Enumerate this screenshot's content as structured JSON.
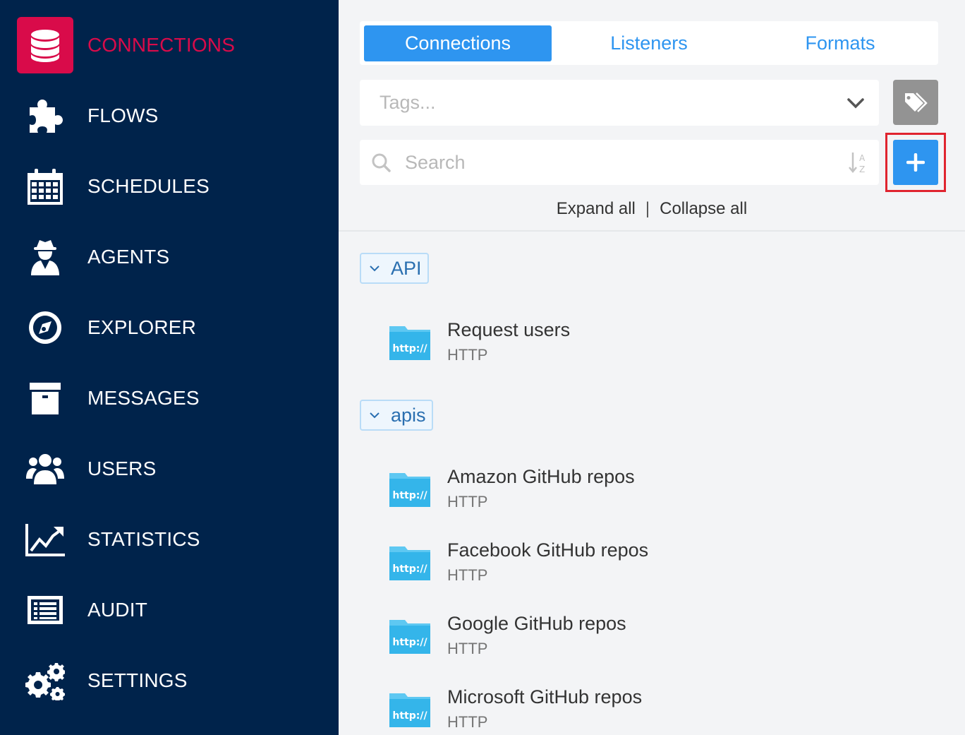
{
  "sidebar": {
    "items": [
      {
        "label": "CONNECTIONS",
        "icon": "database-icon",
        "active": true
      },
      {
        "label": "FLOWS",
        "icon": "puzzle-icon"
      },
      {
        "label": "SCHEDULES",
        "icon": "calendar-icon"
      },
      {
        "label": "AGENTS",
        "icon": "agent-icon"
      },
      {
        "label": "EXPLORER",
        "icon": "compass-icon"
      },
      {
        "label": "MESSAGES",
        "icon": "archive-icon"
      },
      {
        "label": "USERS",
        "icon": "users-icon"
      },
      {
        "label": "STATISTICS",
        "icon": "chart-line-icon"
      },
      {
        "label": "AUDIT",
        "icon": "list-icon"
      },
      {
        "label": "SETTINGS",
        "icon": "gears-icon"
      }
    ]
  },
  "tabs": [
    {
      "label": "Connections",
      "active": true
    },
    {
      "label": "Listeners"
    },
    {
      "label": "Formats"
    }
  ],
  "tags": {
    "placeholder": "Tags..."
  },
  "search": {
    "placeholder": "Search"
  },
  "actions": {
    "expand_all": "Expand all",
    "separator": "|",
    "collapse_all": "Collapse all"
  },
  "groups": [
    {
      "name": "API",
      "items": [
        {
          "name": "Request users",
          "type": "HTTP"
        }
      ]
    },
    {
      "name": "apis",
      "items": [
        {
          "name": "Amazon GitHub repos",
          "type": "HTTP"
        },
        {
          "name": "Facebook GitHub repos",
          "type": "HTTP"
        },
        {
          "name": "Google GitHub repos",
          "type": "HTTP"
        },
        {
          "name": "Microsoft GitHub repos",
          "type": "HTTP"
        }
      ]
    }
  ],
  "icon_text": {
    "http": "http://"
  },
  "colors": {
    "sidebar_bg": "#00234b",
    "accent_red": "#d90b4a",
    "primary_blue": "#2e95f0",
    "highlight_red": "#e0242f"
  }
}
